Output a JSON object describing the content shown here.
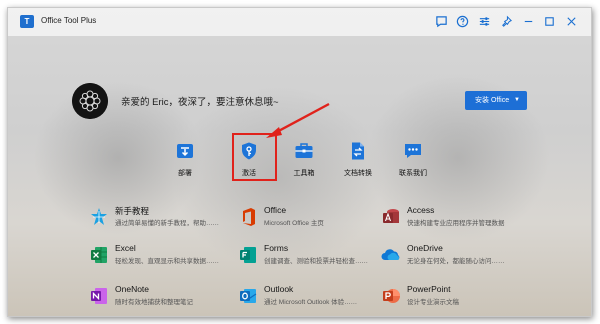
{
  "window": {
    "title": "Office Tool Plus",
    "logo_text": "T"
  },
  "titlebar_icons": [
    "feedback-icon",
    "help-icon",
    "settings-sliders-icon",
    "pin-icon",
    "minimize-icon",
    "maximize-icon",
    "close-icon"
  ],
  "greeting": "亲爱的 Eric，夜深了，要注意休息哦~",
  "install_button": {
    "label": "安装 Office",
    "caret": "▼"
  },
  "nav": [
    {
      "id": "deploy",
      "label": "部署",
      "icon": "deploy-icon"
    },
    {
      "id": "activate",
      "label": "激活",
      "icon": "shield-key-icon"
    },
    {
      "id": "toolbox",
      "label": "工具箱",
      "icon": "toolbox-icon"
    },
    {
      "id": "convert",
      "label": "文档转换",
      "icon": "doc-convert-icon"
    },
    {
      "id": "contact",
      "label": "联系我们",
      "icon": "chat-icon"
    }
  ],
  "apps": [
    {
      "name": "新手教程",
      "desc": "通过简单易懂的新手教程，帮助……",
      "icon": "tutorial-icon",
      "color": "#1ba1e2"
    },
    {
      "name": "Office",
      "desc": "Microsoft Office 主页",
      "icon": "office-icon",
      "color": "#d83b01"
    },
    {
      "name": "Access",
      "desc": "快速构建专业应用程序并管理数据",
      "icon": "access-icon",
      "color": "#a4373a"
    },
    {
      "name": "Excel",
      "desc": "轻松发现、直观显示和共享数据……",
      "icon": "excel-icon",
      "color": "#107c41"
    },
    {
      "name": "Forms",
      "desc": "创建调查、测验和投票并轻松查……",
      "icon": "forms-icon",
      "color": "#008272"
    },
    {
      "name": "OneDrive",
      "desc": "无论身在何处，都能随心访问……",
      "icon": "onedrive-icon",
      "color": "#0f78d4"
    },
    {
      "name": "OneNote",
      "desc": "随时有效地捕获和整理笔记",
      "icon": "onenote-icon",
      "color": "#7719aa"
    },
    {
      "name": "Outlook",
      "desc": "通过 Microsoft Outlook 体验……",
      "icon": "outlook-icon",
      "color": "#0f6cbd"
    },
    {
      "name": "PowerPoint",
      "desc": "设计专业演示文稿",
      "icon": "powerpoint-icon",
      "color": "#c43e1c"
    }
  ],
  "colors": {
    "accent": "#1d6fd6",
    "highlight": "#e0221b"
  }
}
